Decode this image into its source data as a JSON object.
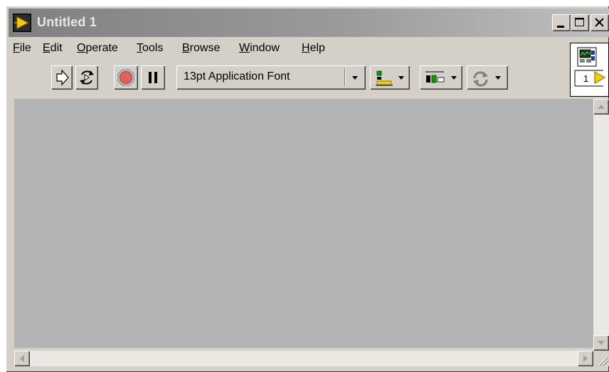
{
  "window": {
    "title": "Untitled 1",
    "controls": [
      {
        "name": "minimize",
        "glyph": "_"
      },
      {
        "name": "maximize",
        "glyph": "□"
      },
      {
        "name": "close",
        "glyph": "×"
      }
    ]
  },
  "menubar": {
    "items": [
      {
        "label": "File",
        "accel": "F"
      },
      {
        "label": "Edit",
        "accel": "E"
      },
      {
        "label": "Operate",
        "accel": "O"
      },
      {
        "label": "Tools",
        "accel": "T"
      },
      {
        "label": "Browse",
        "accel": "B"
      },
      {
        "label": "Window",
        "accel": "W"
      },
      {
        "label": "Help",
        "accel": "H"
      }
    ]
  },
  "toolbar": {
    "run_icon": "run-arrow-icon",
    "run_continuously_icon": "run-continuously-icon",
    "abort_icon": "abort-stop-icon",
    "pause_icon": "pause-icon",
    "font_select_value": "13pt Application Font",
    "align_icon": "align-objects-icon",
    "distribute_icon": "distribute-objects-icon",
    "reorder_icon": "reorder-icon"
  },
  "connector_pane": {
    "terminal_number": "1"
  },
  "colors": {
    "title_bar_inactive": "#808080",
    "canvas": "#b3b3b3",
    "face": "#d4d0c8",
    "abort_red": "#e06060"
  }
}
